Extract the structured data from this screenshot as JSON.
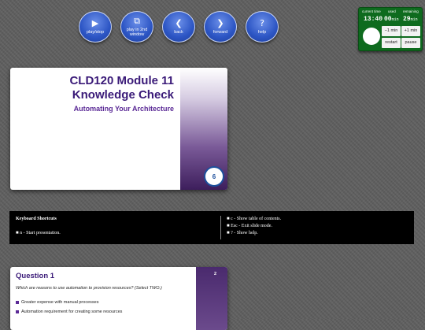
{
  "nav": {
    "play": {
      "label": "play/stop",
      "icon": "▶"
    },
    "play2": {
      "label": "play in 2nd window",
      "icon": "⧉"
    },
    "back": {
      "label": "back",
      "icon": "❮"
    },
    "forward": {
      "label": "forward",
      "icon": "❯"
    },
    "help": {
      "label": "help",
      "icon": "?"
    }
  },
  "timer": {
    "current_time_label": "current time",
    "used_label": "used",
    "remaining_label": "remaining",
    "current_time": "13:40",
    "used": "00",
    "used_unit": "min",
    "remaining": "29",
    "remaining_unit": "min",
    "minus_label": "−1 min",
    "plus_label": "+1 min",
    "restart_label": "restart",
    "pause_label": "pause"
  },
  "slide1": {
    "title_line1": "CLD120 Module 11",
    "title_line2": "Knowledge Check",
    "subtitle": "Automating Your Architecture",
    "logo_text": "6"
  },
  "shortcuts": {
    "heading": "Keyboard Shortcuts",
    "left_items": [
      "n - Start presentation."
    ],
    "right_items": [
      "c - Show table of contents.",
      "Esc - Exit slide mode.",
      "? - Show help."
    ]
  },
  "slide2": {
    "number": "2",
    "title": "Question 1",
    "question": "Which are reasons to use automation to provision resources? (Select TWO.)",
    "options": [
      "Greater expense with manual processes",
      "Automation requirement for creating some resources"
    ]
  },
  "colors": {
    "accent": "#3a1a78",
    "timer_bg": "#0e6b1e",
    "nav_blue": "#2c55c4"
  }
}
